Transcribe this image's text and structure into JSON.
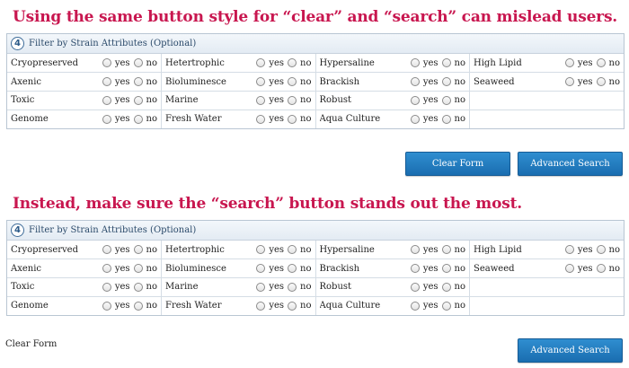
{
  "headline_top": "Using the same button style for “clear” and “search” can mislead users.",
  "headline_bottom": "Instead, make sure the “search” button stands out the most.",
  "panel": {
    "step_number": "4",
    "title": "Filter by Strain Attributes (Optional)",
    "yes_label": "yes",
    "no_label": "no",
    "rows": [
      [
        "Cryopreserved",
        "Hetertrophic",
        "Hypersaline",
        "High Lipid"
      ],
      [
        "Axenic",
        "Bioluminesce",
        "Brackish",
        "Seaweed"
      ],
      [
        "Toxic",
        "Marine",
        "Robust",
        ""
      ],
      [
        "Genome",
        "Fresh Water",
        "Aqua Culture",
        ""
      ]
    ]
  },
  "buttons": {
    "clear_form": "Clear Form",
    "advanced_search": "Advanced Search"
  },
  "colors": {
    "headline": "#c8164f",
    "button": "#1f78bf"
  }
}
